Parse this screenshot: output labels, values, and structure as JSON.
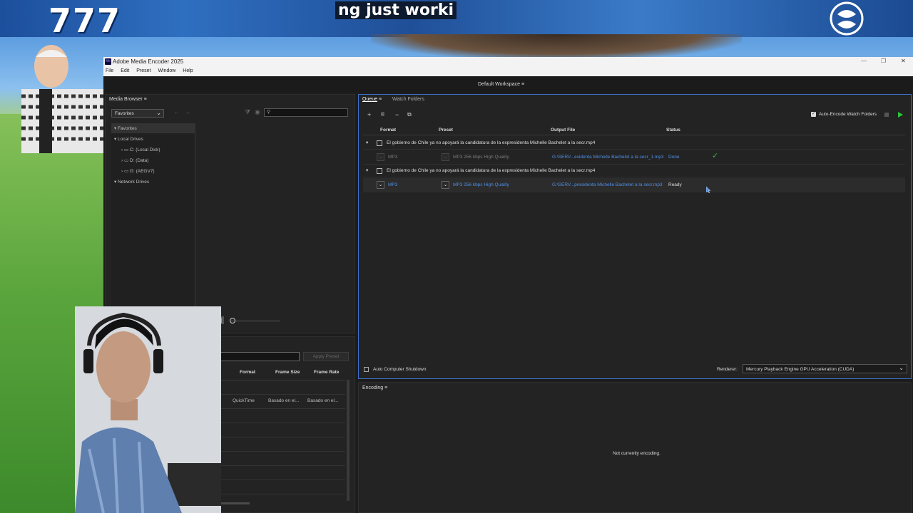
{
  "overlay": {
    "banner_number": "777",
    "banner_text": "ng just worki"
  },
  "window": {
    "title": "Adobe Media Encoder 2025",
    "app_badge": "Me",
    "menu": [
      "File",
      "Edit",
      "Preset",
      "Window",
      "Help"
    ],
    "controls": [
      "—",
      "❐",
      "✕"
    ]
  },
  "workspace": {
    "label": "Default Workspace"
  },
  "media_browser": {
    "title": "Media Browser",
    "location_select": "Favorites",
    "search_placeholder": "",
    "tree": [
      {
        "label": "Favorites",
        "expanded": true
      },
      {
        "label": "Local Drives",
        "expanded": true
      },
      {
        "label": "C: (Local Disk)"
      },
      {
        "label": "D: (Data)"
      },
      {
        "label": "G: (AEGV7)"
      },
      {
        "label": "Network Drives",
        "expanded": true
      }
    ]
  },
  "preset_browser": {
    "apply_button": "Apply Preset",
    "columns": [
      "Format",
      "Frame Size",
      "Frame Rate"
    ],
    "rows": [
      {
        "format": "QuickTime",
        "frame_size": "Basado en el...",
        "frame_rate": "Basado en el..."
      }
    ]
  },
  "queue": {
    "tabs": [
      "Queue",
      "Watch Folders"
    ],
    "auto_encode_label": "Auto-Encode Watch Folders",
    "auto_encode_checked": true,
    "columns": [
      "Format",
      "Preset",
      "Output File",
      "Status"
    ],
    "items": [
      {
        "source": "El gobierno de Chile ya no apoyará la candidatura de la expresidenta Michelle Bachelet a la secr.mp4",
        "format": "MP3",
        "preset": "MP3 256 kbps High Quality",
        "output": "G:\\SERV...esidenta Michelle Bachelet a la secr_1.mp3",
        "status": "Done",
        "done": true
      },
      {
        "source": "El gobierno de Chile ya no apoyará la candidatura de la expresidenta Michelle Bachelet a la secr.mp4",
        "format": "MP3",
        "preset": "MP3 256 kbps High Quality",
        "output": "G:\\SERV...presidenta Michelle Bachelet a la secr.mp3",
        "status": "Ready",
        "done": false
      }
    ],
    "auto_shutdown_label": "Auto Computer Shutdown",
    "renderer_label": "Renderer:",
    "renderer_value": "Mercury Playback Engine GPU Acceleration (CUDA)"
  },
  "encoding": {
    "title": "Encoding",
    "status": "Not currently encoding."
  },
  "colors": {
    "accent_blue": "#4f8fe6",
    "done_green": "#3cb043",
    "play_green": "#2fc23a"
  }
}
